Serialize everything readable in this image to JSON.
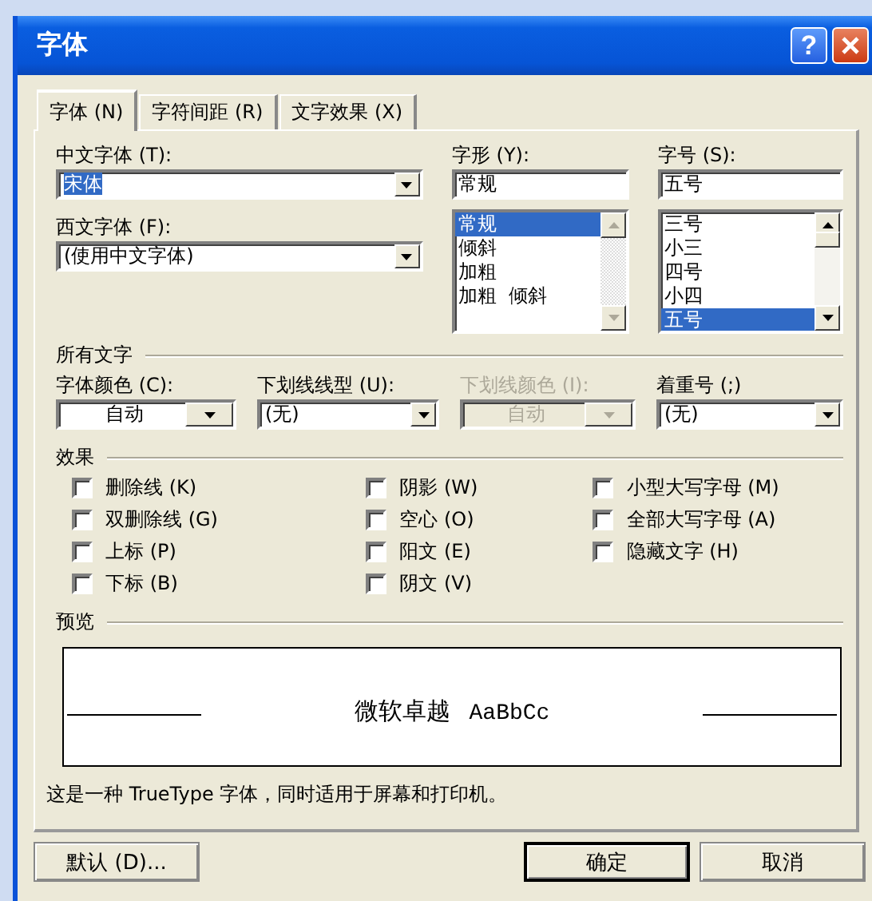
{
  "window": {
    "title": "字体",
    "help_label": "?"
  },
  "tabs": [
    {
      "label": "字体 (N)",
      "selected": true
    },
    {
      "label": "字符间距 (R)",
      "selected": false
    },
    {
      "label": "文字效果 (X)",
      "selected": false
    }
  ],
  "fonts": [
    {
      "label": "中文字体 (T):",
      "value": "宋体",
      "highlighted": true
    },
    {
      "label": "西文字体 (F):",
      "value": "(使用中文字体)",
      "highlighted": false
    }
  ],
  "style": {
    "label": "字形 (Y):",
    "value": "常规",
    "scroll_enabled": false,
    "items": [
      {
        "text": "常规",
        "selected": true
      },
      {
        "text": "倾斜",
        "selected": false
      },
      {
        "text": "加粗",
        "selected": false
      },
      {
        "text": "加粗  倾斜",
        "selected": false
      }
    ]
  },
  "size": {
    "label": "字号 (S):",
    "value": "五号",
    "scroll_enabled": true,
    "items": [
      {
        "text": "三号",
        "selected": false
      },
      {
        "text": "小三",
        "selected": false
      },
      {
        "text": "四号",
        "selected": false
      },
      {
        "text": "小四",
        "selected": false
      },
      {
        "text": "五号",
        "selected": true
      }
    ]
  },
  "all_text": {
    "heading": "所有文字",
    "dropdowns": [
      {
        "label": "字体颜色 (C):",
        "value": "自动",
        "kind": "color",
        "disabled": false
      },
      {
        "label": "下划线线型 (U):",
        "value": "(无)",
        "kind": "list",
        "disabled": false
      },
      {
        "label": "下划线颜色 (I):",
        "value": "自动",
        "kind": "color",
        "disabled": true
      },
      {
        "label": "着重号 (;)",
        "value": "(无)",
        "kind": "list",
        "disabled": false
      }
    ]
  },
  "effects": {
    "heading": "效果",
    "columns": [
      {
        "items": [
          {
            "label": "删除线 (K)",
            "checked": false
          },
          {
            "label": "双删除线 (G)",
            "checked": false
          },
          {
            "label": "上标 (P)",
            "checked": false
          },
          {
            "label": "下标 (B)",
            "checked": false
          }
        ]
      },
      {
        "items": [
          {
            "label": "阴影 (W)",
            "checked": false
          },
          {
            "label": "空心 (O)",
            "checked": false
          },
          {
            "label": "阳文 (E)",
            "checked": false
          },
          {
            "label": "阴文 (V)",
            "checked": false
          }
        ]
      },
      {
        "items": [
          {
            "label": "小型大写字母 (M)",
            "checked": false
          },
          {
            "label": "全部大写字母 (A)",
            "checked": false
          },
          {
            "label": "隐藏文字 (H)",
            "checked": false
          }
        ]
      }
    ]
  },
  "preview": {
    "heading": "预览",
    "sample_cjk": "微软卓越",
    "sample_latin": "AaBbCc"
  },
  "description": "这是一种 TrueType 字体，同时适用于屏幕和打印机。",
  "buttons": [
    {
      "label": "默认 (D)...",
      "default": false
    },
    {
      "label": "确定",
      "default": true
    },
    {
      "label": "取消",
      "default": false
    }
  ]
}
